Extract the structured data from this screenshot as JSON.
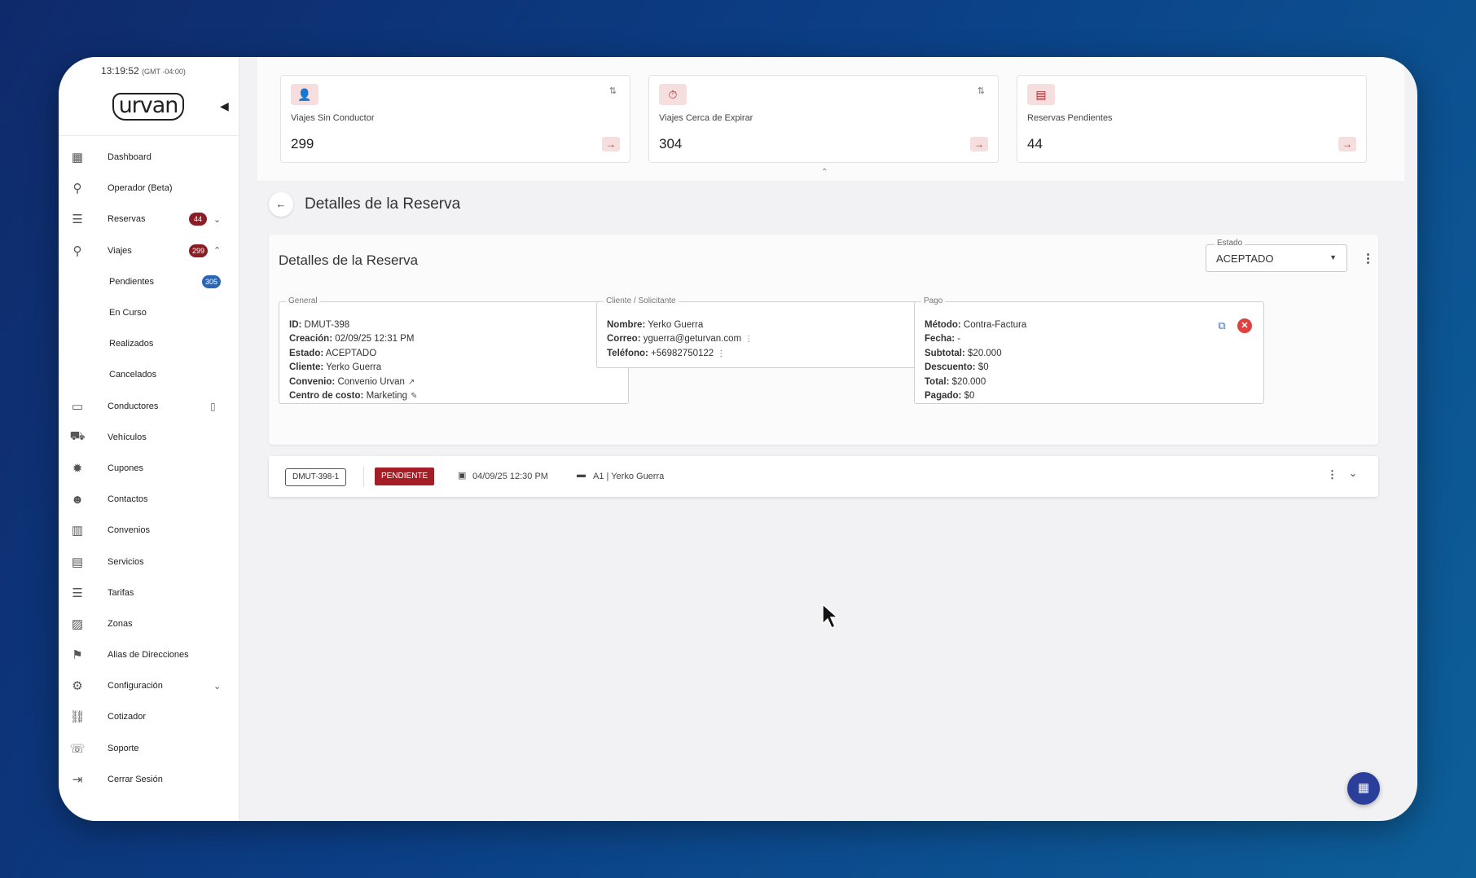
{
  "clock": {
    "time": "13:19:52",
    "tz": "(GMT -04:00)"
  },
  "brand": {
    "logo_text": "urvan"
  },
  "sidebar": {
    "items": [
      {
        "label": "Dashboard",
        "icon": "dashboard-icon"
      },
      {
        "label": "Operador (Beta)",
        "icon": "route-icon"
      },
      {
        "label": "Reservas",
        "icon": "list-icon",
        "badge": "44",
        "chevron": "down"
      },
      {
        "label": "Viajes",
        "icon": "route-icon",
        "badge": "299",
        "chevron": "up"
      },
      {
        "label": "Pendientes",
        "sub": true,
        "badge": "305",
        "badge_color": "#2b66b6"
      },
      {
        "label": "En Curso",
        "sub": true
      },
      {
        "label": "Realizados",
        "sub": true
      },
      {
        "label": "Cancelados",
        "sub": true
      },
      {
        "label": "Conductores",
        "icon": "id-card-icon",
        "extra": "map-icon"
      },
      {
        "label": "Vehículos",
        "icon": "car-icon"
      },
      {
        "label": "Cupones",
        "icon": "badge-icon"
      },
      {
        "label": "Contactos",
        "icon": "people-icon"
      },
      {
        "label": "Convenios",
        "icon": "building-icon"
      },
      {
        "label": "Servicios",
        "icon": "grid-list-icon"
      },
      {
        "label": "Tarifas",
        "icon": "list-icon"
      },
      {
        "label": "Zonas",
        "icon": "map-add-icon"
      },
      {
        "label": "Alias de Direcciones",
        "icon": "pin-icon"
      },
      {
        "label": "Configuración",
        "icon": "gear-icon",
        "chevron": "down"
      },
      {
        "label": "Cotizador",
        "icon": "link-icon"
      },
      {
        "label": "Soporte",
        "icon": "support-icon"
      },
      {
        "label": "Cerrar Sesión",
        "icon": "logout-icon"
      }
    ]
  },
  "kpis": [
    {
      "title": "Viajes Sin Conductor",
      "value": "299",
      "icon": "person-off-icon"
    },
    {
      "title": "Viajes Cerca de Expirar",
      "value": "304",
      "icon": "timer-icon"
    },
    {
      "title": "Reservas Pendientes",
      "value": "44",
      "icon": "list-icon"
    }
  ],
  "page": {
    "title": "Detalles de la Reserva"
  },
  "details": {
    "title": "Detalles de la Reserva",
    "estado_label": "Estado",
    "estado_value": "ACEPTADO",
    "general": {
      "legend": "General",
      "id_label": "ID:",
      "id": "DMUT-398",
      "creacion_label": "Creación:",
      "creacion": "02/09/25 12:31 PM",
      "estado_label": "Estado:",
      "estado": "ACEPTADO",
      "cliente_label": "Cliente:",
      "cliente": "Yerko Guerra",
      "convenio_label": "Convenio:",
      "convenio": "Convenio Urvan",
      "centro_label": "Centro de costo:",
      "centro": "Marketing"
    },
    "cliente": {
      "legend": "Cliente / Solicitante",
      "nombre_label": "Nombre:",
      "nombre": "Yerko Guerra",
      "correo_label": "Correo:",
      "correo": "yguerra@geturvan.com",
      "telefono_label": "Teléfono:",
      "telefono": "+56982750122"
    },
    "pago": {
      "legend": "Pago",
      "metodo_label": "Método:",
      "metodo": "Contra-Factura",
      "fecha_label": "Fecha:",
      "fecha": "-",
      "subtotal_label": "Subtotal:",
      "subtotal": "$20.000",
      "descuento_label": "Descuento:",
      "descuento": "$0",
      "total_label": "Total:",
      "total": "$20.000",
      "pagado_label": "Pagado:",
      "pagado": "$0"
    }
  },
  "trip": {
    "code": "DMUT-398-1",
    "status": "PENDIENTE",
    "date": "04/09/25 12:30 PM",
    "driver": "A1 | Yerko Guerra"
  },
  "colors": {
    "accent": "#8d1d24",
    "status_pending": "#a61e25",
    "fab": "#2b3f9a",
    "badge_blue": "#2b66b6"
  }
}
